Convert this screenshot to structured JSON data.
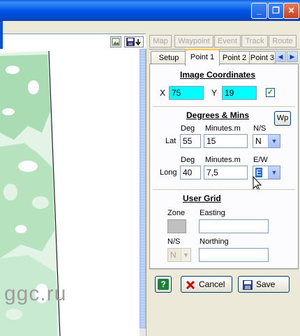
{
  "window": {
    "minimize_glyph": "_",
    "maximize_glyph": "❐",
    "close_glyph": "✕"
  },
  "toolbar": {
    "map_label": "Map",
    "waypoint_label": "Waypoint",
    "event_label": "Event",
    "track_label": "Track",
    "route_label": "Route"
  },
  "map": {
    "watermark": "ggc.ru"
  },
  "tabs": [
    {
      "label": "Setup"
    },
    {
      "label": "Point 1"
    },
    {
      "label": "Point 2"
    },
    {
      "label": "Point 3"
    }
  ],
  "image_coordinates": {
    "heading": "Image Coordinates",
    "x_label": "X",
    "x_value": "75",
    "y_label": "Y",
    "y_value": "19",
    "checked": true
  },
  "degrees_mins": {
    "heading": "Degrees & Mins",
    "wp_label": "Wp",
    "deg_header": "Deg",
    "minutes_header": "Minutes.m",
    "ns_header": "N/S",
    "ew_header": "E/W",
    "lat_label": "Lat",
    "lat_deg": "55",
    "lat_min": "15",
    "lat_ns": "N",
    "long_label": "Long",
    "long_deg": "40",
    "long_min": "7,5",
    "long_ew": "E"
  },
  "user_grid": {
    "heading": "User Grid",
    "zone_label": "Zone",
    "easting_label": "Easting",
    "ns_label": "N/S",
    "ns_value": "N",
    "northing_label": "Northing"
  },
  "buttons": {
    "help_label": "?",
    "cancel_label": "Cancel",
    "save_label": "Save"
  }
}
